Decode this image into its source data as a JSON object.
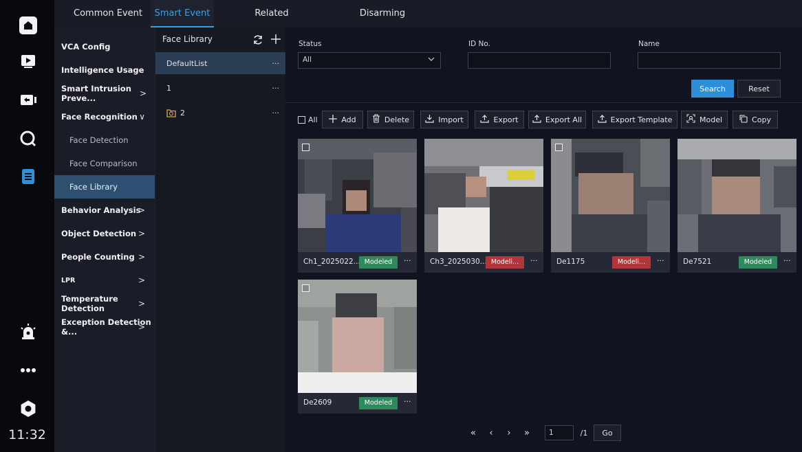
{
  "rail": {
    "icons": [
      "home-icon",
      "playback-icon",
      "backup-icon",
      "search-icon",
      "document-icon",
      "alarm-icon",
      "more-icon",
      "settings-icon"
    ],
    "clock": "11:32",
    "accent": "#2f8fd8"
  },
  "tabs": [
    {
      "label": "Common Event",
      "active": false
    },
    {
      "label": "Smart Event",
      "active": true
    },
    {
      "label": "Related Configuration",
      "active": false
    },
    {
      "label": "Disarming Configuration",
      "active": false
    }
  ],
  "menu": [
    {
      "label": "VCA Config",
      "chevron": ""
    },
    {
      "label": "Intelligence Usage",
      "chevron": ""
    },
    {
      "label": "Smart Intrusion Preve...",
      "chevron": ">"
    },
    {
      "label": "Face Recognition",
      "chevron": "∨"
    },
    {
      "label": "Face Detection",
      "chevron": ""
    },
    {
      "label": "Face Comparison",
      "chevron": ""
    },
    {
      "label": "Face Library",
      "chevron": ""
    },
    {
      "label": "Behavior Analysis",
      "chevron": ">"
    },
    {
      "label": "Object Detection",
      "chevron": ">"
    },
    {
      "label": "People Counting",
      "chevron": ">"
    },
    {
      "label": "LPR",
      "chevron": ">"
    },
    {
      "label": "Temperature Detection",
      "chevron": ">"
    },
    {
      "label": "Exception Detection &...",
      "chevron": ">"
    }
  ],
  "library": {
    "title": "Face Library",
    "refresh_icon": "refresh-icon",
    "add_icon": "plus-icon",
    "rows": [
      {
        "label": "DefaultList",
        "dots": "···"
      },
      {
        "label": "1",
        "dots": "···"
      },
      {
        "label": "2",
        "dots": "···",
        "icon": "folder-sync-icon"
      }
    ]
  },
  "filters": {
    "status_label": "Status",
    "status_value": "All",
    "id_label": "ID No.",
    "id_value": "",
    "name_label": "Name",
    "name_value": "",
    "search_button": "Search",
    "reset_button": "Reset"
  },
  "toolbar": {
    "all_label": "All",
    "add": "Add",
    "delete": "Delete",
    "import": "Import",
    "export": "Export",
    "export_all": "Export All",
    "export_template": "Export Template",
    "model": "Model",
    "copy": "Copy"
  },
  "cards": [
    {
      "name": "Ch1_2025022...",
      "status": "Modeled",
      "status_color": "#2e8a5c",
      "dots": "···"
    },
    {
      "name": "Ch3_2025030...",
      "status": "Modeli...",
      "status_color": "#b2353c",
      "dots": "···"
    },
    {
      "name": "De1175",
      "status": "Modeli...",
      "status_color": "#b2353c",
      "dots": "···"
    },
    {
      "name": "De7521",
      "status": "Modeled",
      "status_color": "#2e8a5c",
      "dots": "···"
    },
    {
      "name": "De2609",
      "status": "Modeled",
      "status_color": "#2e8a5c",
      "dots": "···"
    }
  ],
  "pagination": {
    "first": "«",
    "prev": "‹",
    "next": "›",
    "last": "»",
    "page": "1",
    "total": "/1",
    "go": "Go"
  }
}
